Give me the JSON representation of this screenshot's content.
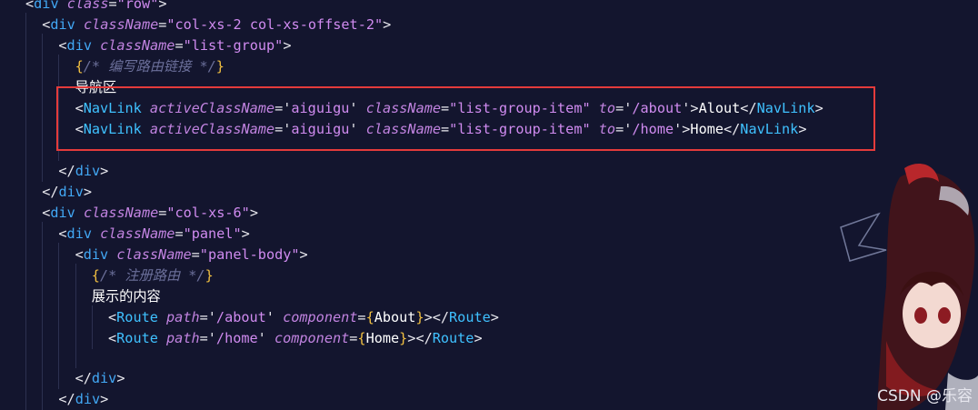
{
  "code_lines": [
    [
      [
        "punct",
        "<"
      ],
      [
        "tagname",
        "div"
      ],
      [
        "punct",
        " "
      ],
      [
        "attr",
        "class"
      ],
      [
        "eq",
        "="
      ],
      [
        "str",
        "\"row\""
      ],
      [
        "punct",
        ">"
      ]
    ],
    [
      [
        "punct",
        "<"
      ],
      [
        "tagname",
        "div"
      ],
      [
        "punct",
        " "
      ],
      [
        "attr",
        "className"
      ],
      [
        "eq",
        "="
      ],
      [
        "str",
        "\"col-xs-2 col-xs-offset-2\""
      ],
      [
        "punct",
        ">"
      ]
    ],
    [
      [
        "punct",
        "<"
      ],
      [
        "tagname",
        "div"
      ],
      [
        "punct",
        " "
      ],
      [
        "attr",
        "className"
      ],
      [
        "eq",
        "="
      ],
      [
        "str",
        "\"list-group\""
      ],
      [
        "punct",
        ">"
      ]
    ],
    [
      [
        "brace",
        "{"
      ],
      [
        "cmt",
        "/* 编写路由链接 */"
      ],
      [
        "brace",
        "}"
      ]
    ],
    [
      [
        "txt",
        "导航区"
      ]
    ],
    [
      [
        "punct",
        "<"
      ],
      [
        "tag",
        "NavLink"
      ],
      [
        "punct",
        " "
      ],
      [
        "attr",
        "activeClassName"
      ],
      [
        "eq",
        "="
      ],
      [
        "sq",
        "'"
      ],
      [
        "str",
        "aiguigu"
      ],
      [
        "sq",
        "'"
      ],
      [
        "punct",
        " "
      ],
      [
        "attr",
        "className"
      ],
      [
        "eq",
        "="
      ],
      [
        "str",
        "\"list-group-item\""
      ],
      [
        "punct",
        " "
      ],
      [
        "attr",
        "to"
      ],
      [
        "eq",
        "="
      ],
      [
        "sq",
        "'"
      ],
      [
        "str",
        "/about"
      ],
      [
        "sq",
        "'"
      ],
      [
        "punct",
        ">"
      ],
      [
        "txt",
        "Alout"
      ],
      [
        "punct",
        "</"
      ],
      [
        "tag",
        "NavLink"
      ],
      [
        "punct",
        ">"
      ]
    ],
    [
      [
        "punct",
        "<"
      ],
      [
        "tag",
        "NavLink"
      ],
      [
        "punct",
        " "
      ],
      [
        "attr",
        "activeClassName"
      ],
      [
        "eq",
        "="
      ],
      [
        "sq",
        "'"
      ],
      [
        "str",
        "aiguigu"
      ],
      [
        "sq",
        "'"
      ],
      [
        "punct",
        " "
      ],
      [
        "attr",
        "className"
      ],
      [
        "eq",
        "="
      ],
      [
        "str",
        "\"list-group-item\""
      ],
      [
        "punct",
        " "
      ],
      [
        "attr",
        "to"
      ],
      [
        "eq",
        "="
      ],
      [
        "sq",
        "'"
      ],
      [
        "str",
        "/home"
      ],
      [
        "sq",
        "'"
      ],
      [
        "punct",
        ">"
      ],
      [
        "txt",
        "Home"
      ],
      [
        "punct",
        "</"
      ],
      [
        "tag",
        "NavLink"
      ],
      [
        "punct",
        ">"
      ]
    ],
    [],
    [
      [
        "punct",
        "</"
      ],
      [
        "tagname",
        "div"
      ],
      [
        "punct",
        ">"
      ]
    ],
    [
      [
        "punct",
        "</"
      ],
      [
        "tagname",
        "div"
      ],
      [
        "punct",
        ">"
      ]
    ],
    [
      [
        "punct",
        "<"
      ],
      [
        "tagname",
        "div"
      ],
      [
        "punct",
        " "
      ],
      [
        "attr",
        "className"
      ],
      [
        "eq",
        "="
      ],
      [
        "str",
        "\"col-xs-6\""
      ],
      [
        "punct",
        ">"
      ]
    ],
    [
      [
        "punct",
        "<"
      ],
      [
        "tagname",
        "div"
      ],
      [
        "punct",
        " "
      ],
      [
        "attr",
        "className"
      ],
      [
        "eq",
        "="
      ],
      [
        "str",
        "\"panel\""
      ],
      [
        "punct",
        ">"
      ]
    ],
    [
      [
        "punct",
        "<"
      ],
      [
        "tagname",
        "div"
      ],
      [
        "punct",
        " "
      ],
      [
        "attr",
        "className"
      ],
      [
        "eq",
        "="
      ],
      [
        "str",
        "\"panel-body\""
      ],
      [
        "punct",
        ">"
      ]
    ],
    [
      [
        "brace",
        "{"
      ],
      [
        "cmt",
        "/* 注册路由 */"
      ],
      [
        "brace",
        "}"
      ]
    ],
    [
      [
        "txt",
        "展示的内容"
      ]
    ],
    [
      [
        "punct",
        "<"
      ],
      [
        "tag",
        "Route"
      ],
      [
        "punct",
        " "
      ],
      [
        "attr",
        "path"
      ],
      [
        "eq",
        "="
      ],
      [
        "sq",
        "'"
      ],
      [
        "str",
        "/about"
      ],
      [
        "sq",
        "'"
      ],
      [
        "punct",
        " "
      ],
      [
        "attr",
        "component"
      ],
      [
        "eq",
        "="
      ],
      [
        "brace",
        "{"
      ],
      [
        "txt",
        "About"
      ],
      [
        "brace",
        "}"
      ],
      [
        "punct",
        "></"
      ],
      [
        "tag",
        "Route"
      ],
      [
        "punct",
        ">"
      ]
    ],
    [
      [
        "punct",
        "<"
      ],
      [
        "tag",
        "Route"
      ],
      [
        "punct",
        " "
      ],
      [
        "attr",
        "path"
      ],
      [
        "eq",
        "="
      ],
      [
        "sq",
        "'"
      ],
      [
        "str",
        "/home"
      ],
      [
        "sq",
        "'"
      ],
      [
        "punct",
        " "
      ],
      [
        "attr",
        "component"
      ],
      [
        "eq",
        "="
      ],
      [
        "brace",
        "{"
      ],
      [
        "txt",
        "Home"
      ],
      [
        "brace",
        "}"
      ],
      [
        "punct",
        "></"
      ],
      [
        "tag",
        "Route"
      ],
      [
        "punct",
        ">"
      ]
    ],
    [],
    [
      [
        "punct",
        "</"
      ],
      [
        "tagname",
        "div"
      ],
      [
        "punct",
        ">"
      ]
    ],
    [
      [
        "punct",
        "</"
      ],
      [
        "tagname",
        "div"
      ],
      [
        "punct",
        ">"
      ]
    ]
  ],
  "watermark": "CSDN @乐容",
  "colors": {
    "background": "#13152e",
    "highlight_box": "#e43b3b"
  }
}
